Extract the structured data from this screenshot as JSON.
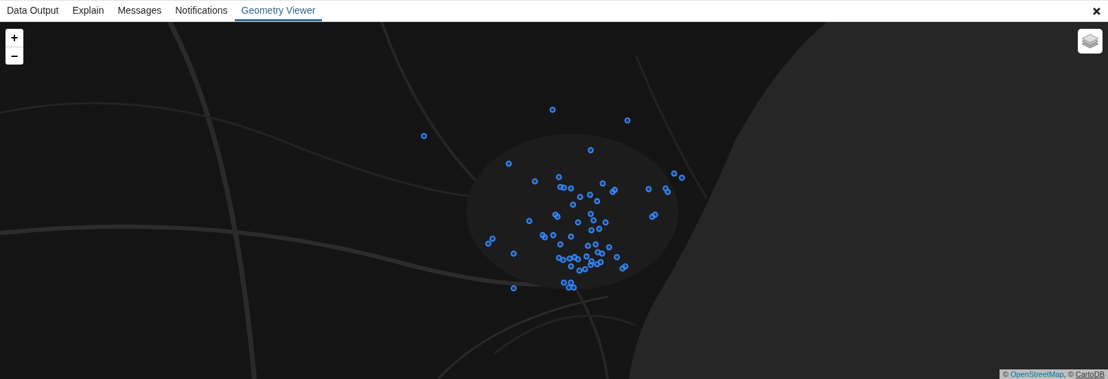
{
  "tabs": [
    {
      "label": "Data Output",
      "selected": false
    },
    {
      "label": "Explain",
      "selected": false
    },
    {
      "label": "Messages",
      "selected": false
    },
    {
      "label": "Notifications",
      "selected": false
    },
    {
      "label": "Geometry Viewer",
      "selected": true
    }
  ],
  "map": {
    "kind": "picture",
    "zoom_in": "+",
    "zoom_out": "−",
    "attribution": [
      {
        "kind": "text",
        "text": "© "
      },
      {
        "kind": "link",
        "text": "OpenStreetMap"
      },
      {
        "kind": "text",
        "text": ", © "
      },
      {
        "kind": "link",
        "text": "CartoDB"
      }
    ]
  }
}
